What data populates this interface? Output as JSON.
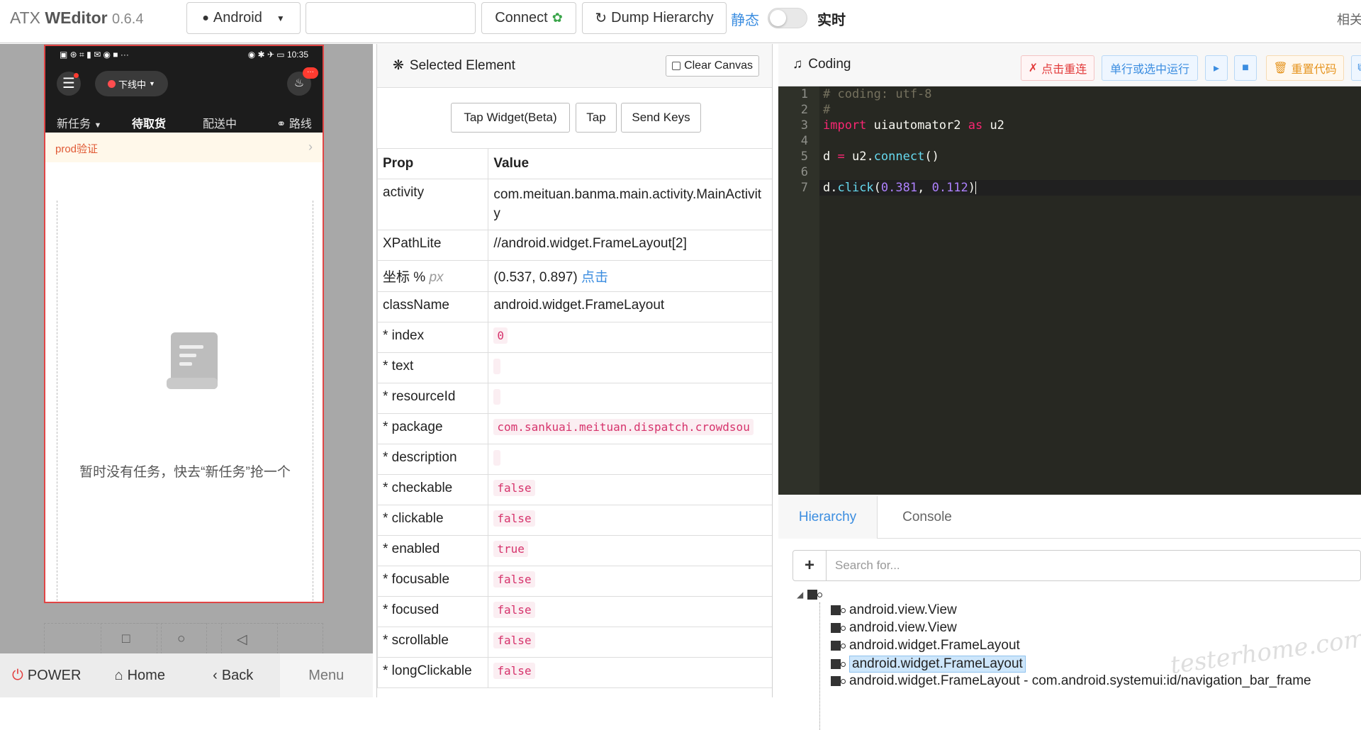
{
  "topbar": {
    "brand_prefix": "ATX ",
    "brand_name": "WEditor",
    "version": "0.6.4",
    "platform_label": "Android",
    "device_input_value": "",
    "connect_label": "Connect",
    "dump_label": "Dump Hierarchy",
    "mode_static": "静态",
    "mode_live": "实时",
    "related": "相关"
  },
  "phone": {
    "status_left": "▣ ⊛ ⌗ ▮ ✉ ◉ ■ ···",
    "status_right": "◉ ✱ ✈ ▭ 10:35",
    "offline_label": "下线中",
    "bell_badge": "···",
    "tabs": [
      "新任务",
      "待取货",
      "配送中",
      "路线"
    ],
    "prod_label": "prod验证",
    "empty_text": "暂时没有任务，快去“新任务”抢一个"
  },
  "device_buttons": {
    "power": "POWER",
    "home": "Home",
    "back": "Back",
    "menu": "Menu"
  },
  "selected": {
    "title": "Selected Element",
    "clear_label": "Clear Canvas",
    "actions": [
      "Tap Widget(Beta)",
      "Tap",
      "Send Keys"
    ],
    "header_prop": "Prop",
    "header_value": "Value",
    "rows": {
      "activity": {
        "prop": "activity",
        "value": "com.meituan.banma.main.activity.MainActivity"
      },
      "xpath": {
        "prop": "XPathLite",
        "value": "//android.widget.FrameLayout[2]"
      },
      "coord": {
        "prop": "坐标 %",
        "unit": "px",
        "value": "(0.537, 0.897)",
        "link": "点击"
      },
      "classname": {
        "prop": "className",
        "value": "android.widget.FrameLayout"
      },
      "index": {
        "prop": "* index",
        "value": "0"
      },
      "text": {
        "prop": "* text",
        "value": ""
      },
      "resourceid": {
        "prop": "* resourceId",
        "value": ""
      },
      "package": {
        "prop": "* package",
        "value": "com.sankuai.meituan.dispatch.crowdsou"
      },
      "description": {
        "prop": "* description",
        "value": ""
      },
      "checkable": {
        "prop": "* checkable",
        "value": "false"
      },
      "clickable": {
        "prop": "* clickable",
        "value": "false"
      },
      "enabled": {
        "prop": "* enabled",
        "value": "true"
      },
      "focusable": {
        "prop": "* focusable",
        "value": "false"
      },
      "focused": {
        "prop": "* focused",
        "value": "false"
      },
      "scrollable": {
        "prop": "* scrollable",
        "value": "false"
      },
      "longclickable": {
        "prop": "* longClickable",
        "value": "false"
      }
    }
  },
  "coding": {
    "title": "Coding",
    "reconnect_label": "点击重连",
    "run_label": "单行或选中运行",
    "reset_label": "重置代码",
    "line_numbers": [
      "1",
      "2",
      "3",
      "4",
      "5",
      "6",
      "7"
    ],
    "code": {
      "l1": "# coding: utf-8",
      "l2": "#",
      "l3_kw": "import",
      "l3_rest": " uiautomator2 ",
      "l3_as": "as",
      "l3_mod": " u2",
      "l5_var": "d ",
      "l5_eq": "=",
      "l5_obj": " u2.",
      "l5_fn": "connect",
      "l5_paren": "()",
      "l7_obj": "d.",
      "l7_fn": "click",
      "l7_open": "(",
      "l7_x": "0.381",
      "l7_comma": ", ",
      "l7_y": "0.112",
      "l7_close": ")"
    }
  },
  "bottom": {
    "tab_hierarchy": "Hierarchy",
    "tab_console": "Console",
    "search_placeholder": "Search for...",
    "tree": [
      "android.view.View",
      "android.view.View",
      "android.widget.FrameLayout",
      "android.widget.FrameLayout",
      "android.widget.FrameLayout - com.android.systemui:id/navigation_bar_frame"
    ]
  },
  "watermark": "testerhome.com",
  "colors": {
    "accent": "#3b8de0",
    "danger": "#e23b3b",
    "warning": "#e69520",
    "editor_bg": "#272822",
    "phone_border": "#e04545"
  }
}
